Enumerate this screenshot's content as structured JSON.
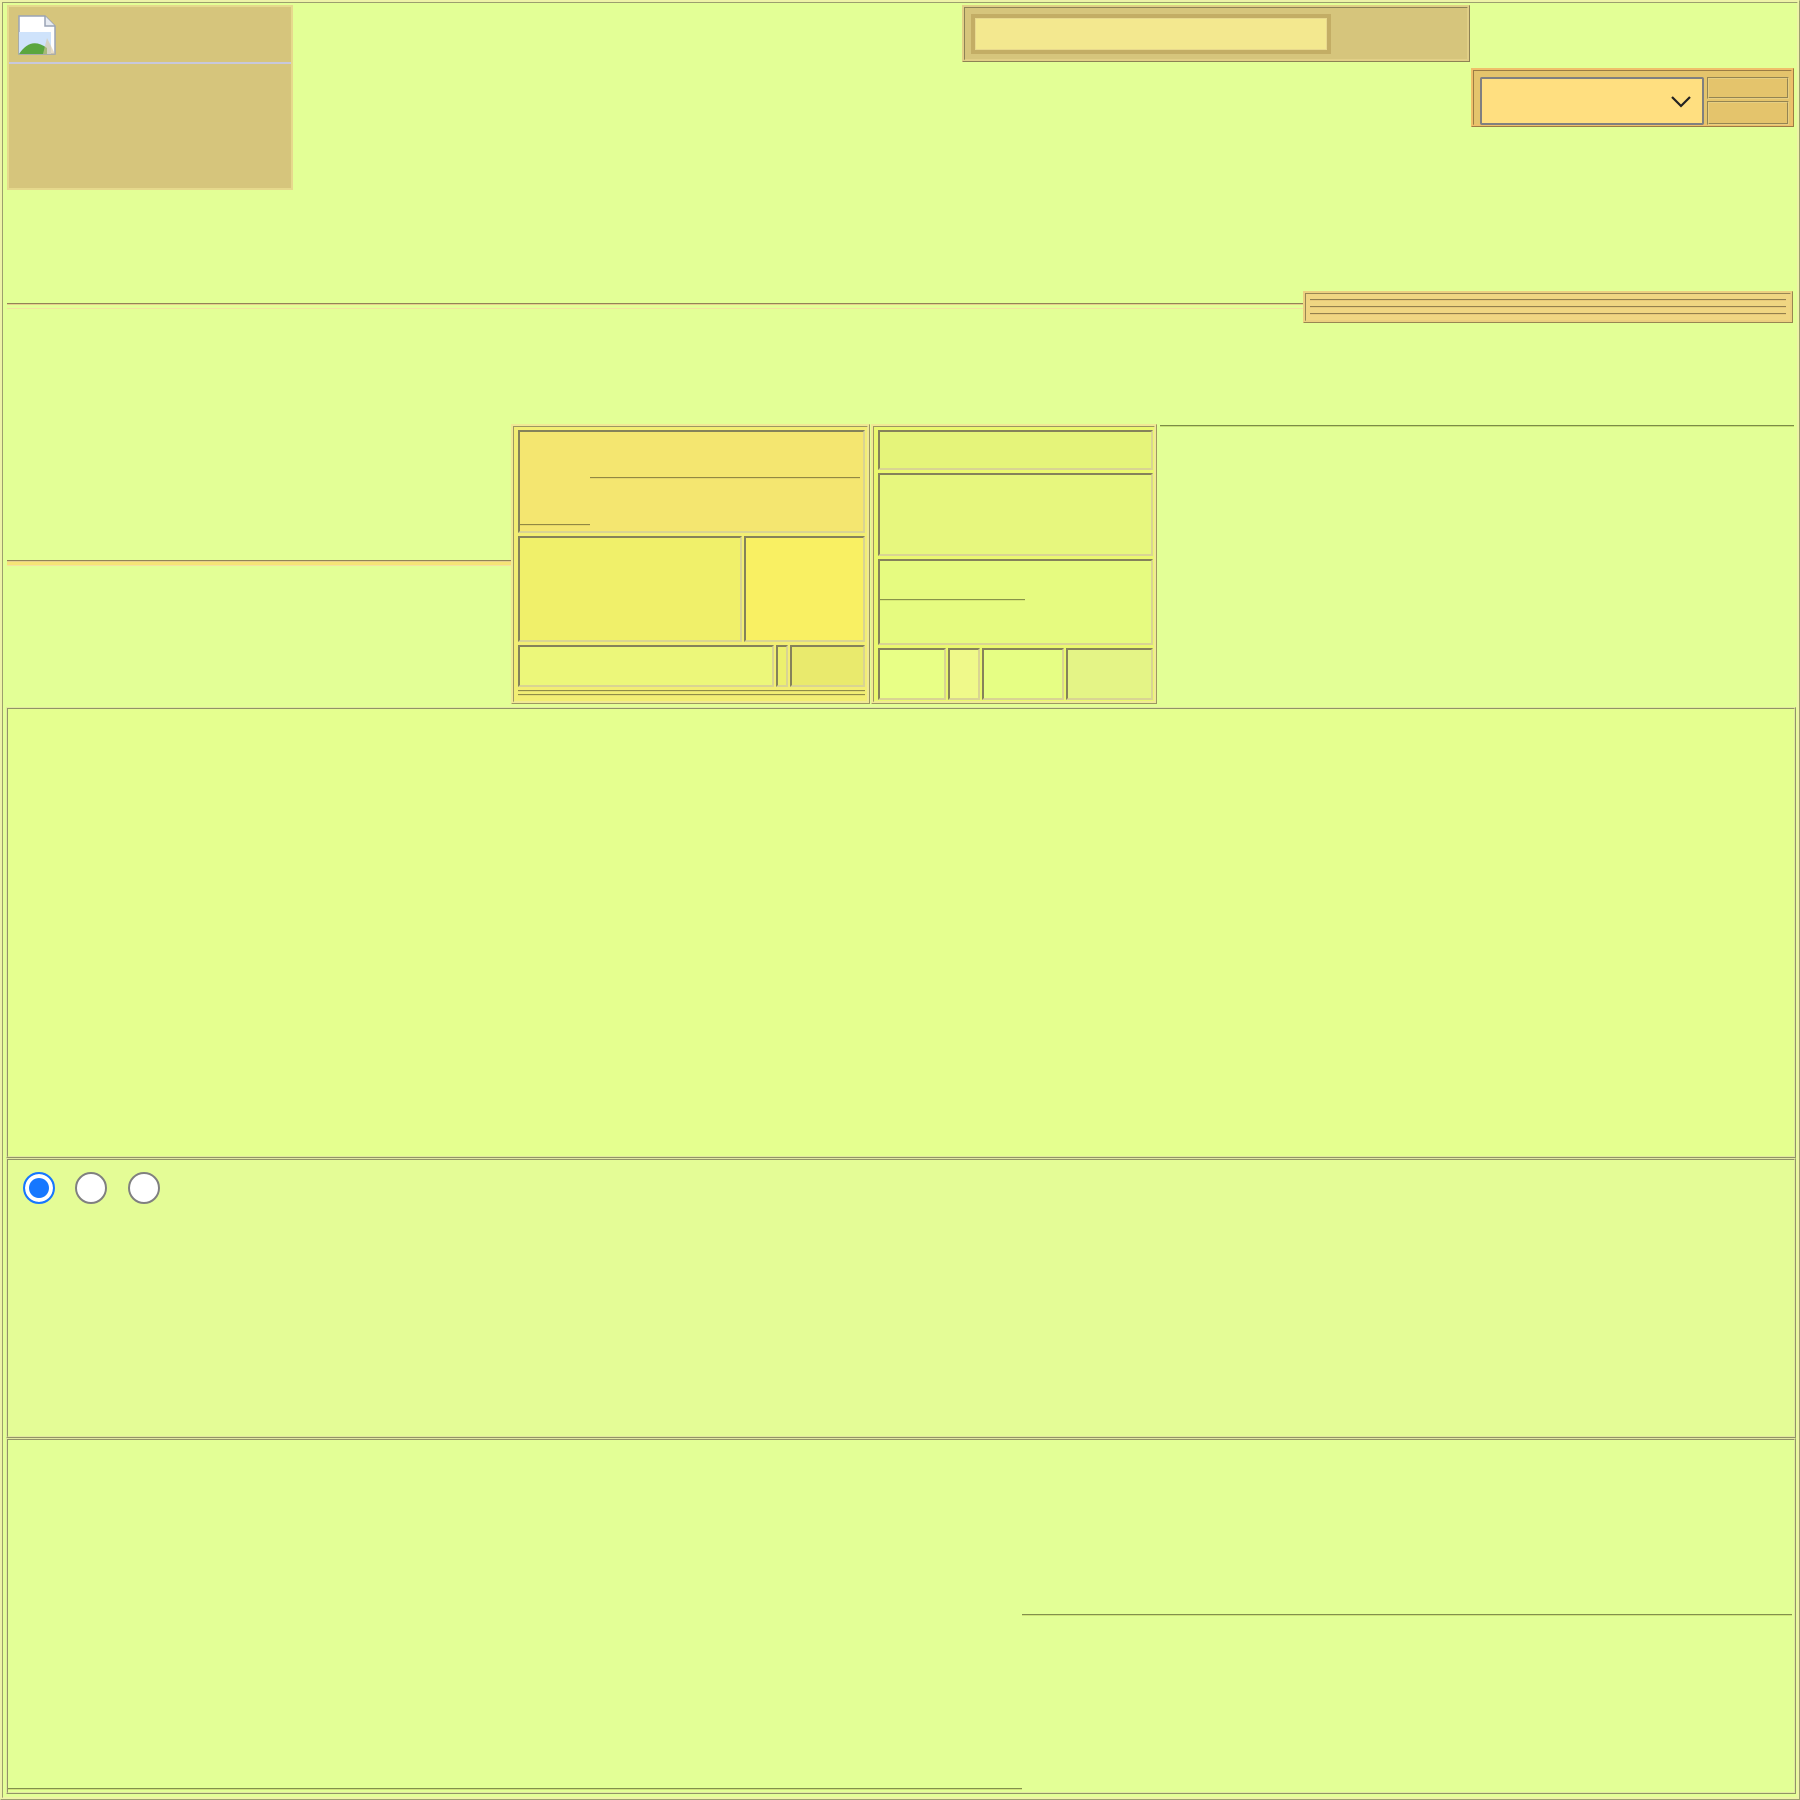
{
  "header": {
    "logo": {
      "icon": "broken-image-icon"
    },
    "search": {
      "value": "",
      "submit_label": ""
    },
    "select": {
      "value": "",
      "icon": "chevron-down-icon"
    }
  },
  "cards_panel": {
    "cells": []
  },
  "radio_group": {
    "options": [
      {
        "label": "",
        "checked": true
      },
      {
        "label": "",
        "checked": false
      },
      {
        "label": "",
        "checked": false
      }
    ]
  },
  "colors": {
    "page_background": "#e3ff96",
    "header_box": "#d6c57c",
    "input_fill": "#f3e88f",
    "select_fill": "#ffdf80",
    "radio_checked": "#1677ff"
  }
}
